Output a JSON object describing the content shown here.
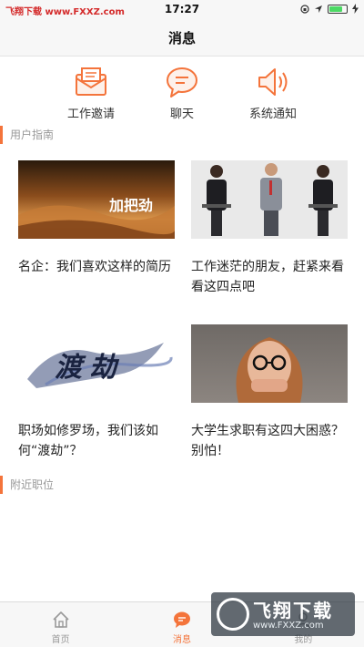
{
  "status": {
    "watermark": "飞翔下载 www.FXXZ.com",
    "time": "17:27"
  },
  "nav": {
    "title": "消息"
  },
  "quick_actions": [
    {
      "label": "工作邀请",
      "icon": "envelope-icon"
    },
    {
      "label": "聊天",
      "icon": "chat-bubble-icon"
    },
    {
      "label": "系统通知",
      "icon": "speaker-icon"
    }
  ],
  "sections": {
    "guide": "用户指南",
    "nearby": "附近职位"
  },
  "articles": [
    {
      "title": "名企：我们喜欢这样的简历",
      "image_text": "加把劲"
    },
    {
      "title": "工作迷茫的朋友，赶紧来看看这四点吧",
      "image_text": ""
    },
    {
      "title": "职场如修罗场，我们该如何“渡劫”？",
      "image_text": "渡劫"
    },
    {
      "title": "大学生求职有这四大困惑？别怕！",
      "image_text": ""
    }
  ],
  "tabs": [
    {
      "label": "首页",
      "icon": "home-icon"
    },
    {
      "label": "消息",
      "icon": "message-icon"
    },
    {
      "label": "我的",
      "icon": "profile-icon"
    }
  ],
  "watermark_badge": {
    "big": "飞翔下载",
    "small": "www.FXXZ.com"
  },
  "colors": {
    "accent": "#f4743b",
    "background": "#ffffff",
    "muted_text": "#999999"
  }
}
